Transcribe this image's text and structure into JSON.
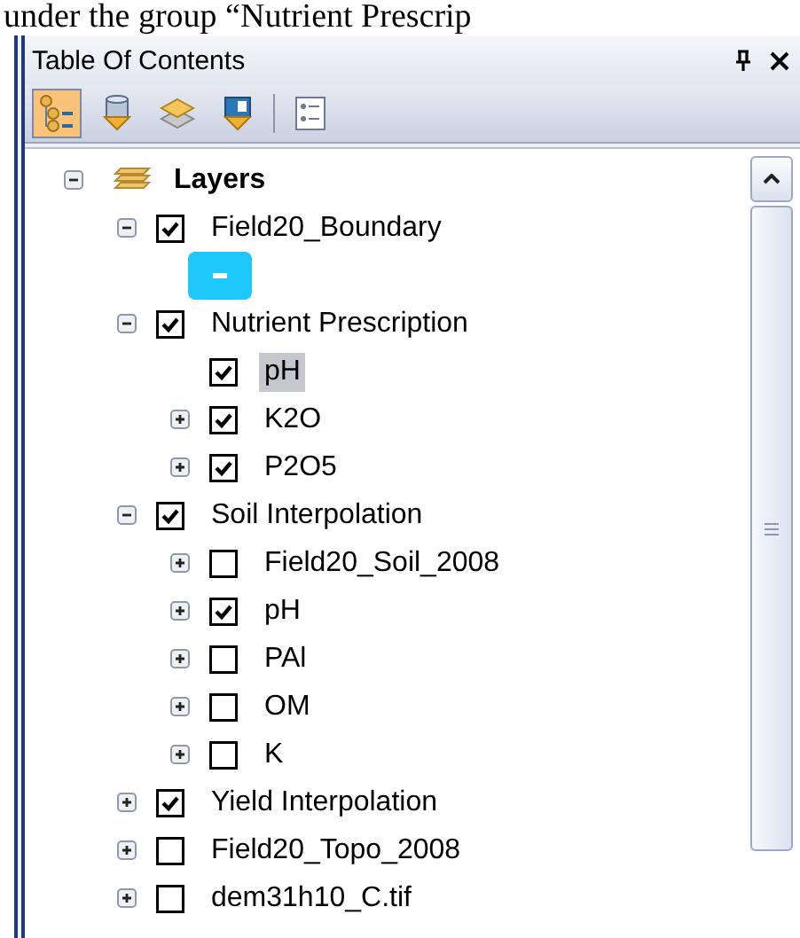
{
  "caption": "under the group “Nutrient Prescrip",
  "window": {
    "title": "Table Of Contents"
  },
  "toolbar": [
    {
      "kind": "order",
      "selected": true
    },
    {
      "kind": "source",
      "selected": false
    },
    {
      "kind": "visibility",
      "selected": false
    },
    {
      "kind": "selection",
      "selected": false
    },
    {
      "kind": "options",
      "selected": false
    }
  ],
  "tree": [
    {
      "kind": "frame",
      "label": "Layers",
      "expanded": true,
      "children": [
        {
          "label": "Field20_Boundary",
          "expanded": true,
          "checked": true,
          "selected": false,
          "children": [
            {
              "kind": "symbol",
              "color": "#1ec8fa"
            }
          ]
        },
        {
          "label": "Nutrient Prescription",
          "expanded": true,
          "checked": true,
          "selected": false,
          "children": [
            {
              "label": "pH",
              "checked": true,
              "selected": true
            },
            {
              "label": "K2O",
              "expanded": false,
              "checked": true,
              "selected": false
            },
            {
              "label": "P2O5",
              "expanded": false,
              "checked": true,
              "selected": false
            }
          ]
        },
        {
          "label": "Soil Interpolation",
          "expanded": true,
          "checked": true,
          "selected": false,
          "children": [
            {
              "label": "Field20_Soil_2008",
              "expanded": false,
              "checked": false,
              "selected": false
            },
            {
              "label": "pH",
              "expanded": false,
              "checked": true,
              "selected": false
            },
            {
              "label": "PAl",
              "expanded": false,
              "checked": false,
              "selected": false
            },
            {
              "label": "OM",
              "expanded": false,
              "checked": false,
              "selected": false
            },
            {
              "label": "K",
              "expanded": false,
              "checked": false,
              "selected": false
            }
          ]
        },
        {
          "label": "Yield Interpolation",
          "expanded": false,
          "checked": true,
          "selected": false
        },
        {
          "label": "Field20_Topo_2008",
          "expanded": false,
          "checked": false,
          "selected": false
        },
        {
          "label": "dem31h10_C.tif",
          "expanded": false,
          "checked": false,
          "selected": false
        }
      ]
    }
  ]
}
